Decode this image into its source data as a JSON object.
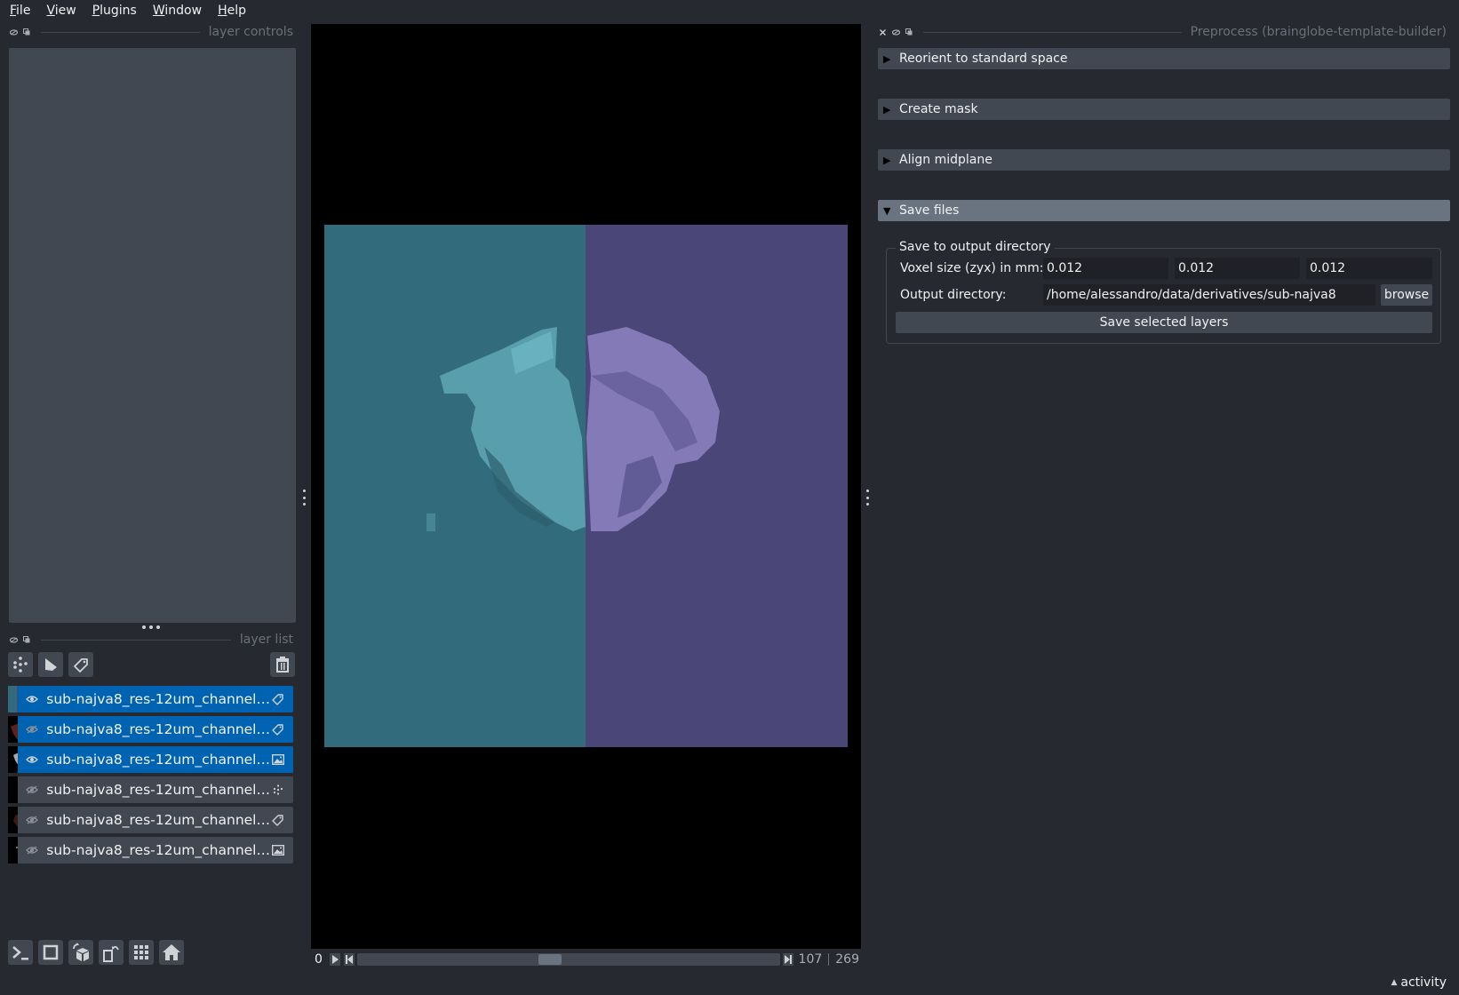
{
  "menu": {
    "items": [
      {
        "label": "File",
        "mnemonic": "F",
        "rest": "ile"
      },
      {
        "label": "View",
        "mnemonic": "V",
        "rest": "iew"
      },
      {
        "label": "Plugins",
        "mnemonic": "P",
        "rest": "lugins"
      },
      {
        "label": "Window",
        "mnemonic": "W",
        "rest": "indow"
      },
      {
        "label": "Help",
        "mnemonic": "H",
        "rest": "elp"
      }
    ]
  },
  "layer_controls": {
    "title": "layer controls"
  },
  "layer_list": {
    "title": "layer list",
    "buttons": {
      "new_points": "new-points-layer",
      "new_shapes": "new-shapes-layer",
      "new_labels": "new-labels-layer",
      "delete": "delete-layer"
    },
    "layers": [
      {
        "name": "sub-najva8_res-12um_channel…",
        "visible": true,
        "selected": true,
        "type": "labels"
      },
      {
        "name": "sub-najva8_res-12um_channel…",
        "visible": false,
        "selected": true,
        "type": "labels"
      },
      {
        "name": "sub-najva8_res-12um_channel…",
        "visible": true,
        "selected": true,
        "type": "image"
      },
      {
        "name": "sub-najva8_res-12um_channel…",
        "visible": false,
        "selected": false,
        "type": "points"
      },
      {
        "name": "sub-najva8_res-12um_channel…",
        "visible": false,
        "selected": false,
        "type": "labels"
      },
      {
        "name": "sub-najva8_res-12um_channel…",
        "visible": false,
        "selected": false,
        "type": "image"
      }
    ]
  },
  "viewer_buttons": [
    "console",
    "ndisplay-2d",
    "roll-dims",
    "transpose-dims",
    "grid-mode",
    "home"
  ],
  "dims": {
    "min": "0",
    "current": "107",
    "max": "269",
    "fraction": 0.398
  },
  "plugin": {
    "title": "Preprocess (brainglobe-template-builder)",
    "sections": [
      {
        "label": "Reorient to standard space",
        "open": false
      },
      {
        "label": "Create mask",
        "open": false
      },
      {
        "label": "Align midplane",
        "open": false
      },
      {
        "label": "Save files",
        "open": true
      }
    ],
    "save": {
      "group_title": "Save to output directory",
      "voxel_label": "Voxel size (zyx) in mm:",
      "voxel_values": [
        "0.012",
        "0.012",
        "0.012"
      ],
      "output_label": "Output directory:",
      "output_value": "/home/alessandro/data/derivatives/sub-najva8",
      "browse_label": "browse",
      "save_button": "Save selected layers"
    }
  },
  "status": {
    "activity_label": "activity"
  },
  "colors": {
    "selected_layer": "#0063b1",
    "panel_bg": "#262930",
    "widget_bg": "#414851",
    "label_left": "#326c7c",
    "label_right": "#4a4677"
  }
}
